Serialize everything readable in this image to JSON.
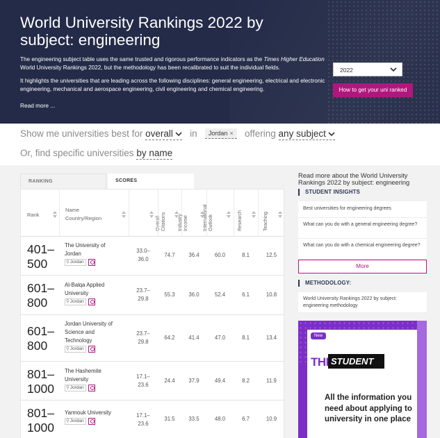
{
  "hero": {
    "title": "World University Rankings 2022 by subject: engineering",
    "desc1_em": "Times Higher Education",
    "desc1_pre": "The engineering subject table uses the same trusted and rigorous performance indicators as the ",
    "desc1_post": " World University Rankings 2022, but the methodology has been recalibrated to suit the individual fields.",
    "desc2": "It highlights the universities that are leading across the following disciplines: general engineering, electrical and electronic engineering, mechanical and aerospace engineering, civil engineering and chemical engineering.",
    "read_more": "Read more ...",
    "year_selected": "2022",
    "cta_label": "How to get your uni ranked"
  },
  "filters": {
    "show_me": "Show me universities best for",
    "sort_value": "overall",
    "in_label": "in",
    "country_chip": "Jordan",
    "chip_remove": "×",
    "offering_label": "offering",
    "subject_value": "any subject",
    "find_label": "Or, find specific universities",
    "find_value": "by name"
  },
  "tabs": {
    "ranking": "RANKING",
    "scores": "SCORES"
  },
  "table": {
    "headers": {
      "rank": "Rank",
      "name": "Name",
      "country": "Country/Region",
      "overall": "Overall",
      "citations": "Citations",
      "industry_1": "Industry",
      "industry_2": "Income",
      "intl_1": "International",
      "intl_2": "Outlook",
      "research": "Research",
      "teaching": "Teaching"
    },
    "rows": [
      {
        "rank_a": "401–",
        "rank_b": "500",
        "name": [
          "The University of",
          "Jordan"
        ],
        "country": "Jordan",
        "overall_a": "33.0–",
        "overall_b": "36.0",
        "citations": "74.7",
        "industry": "36.4",
        "intl": "60.0",
        "research": "8.1",
        "teaching": "12.5"
      },
      {
        "rank_a": "601–",
        "rank_b": "800",
        "name": [
          "Al-Balqa Applied",
          "University"
        ],
        "country": "Jordan",
        "overall_a": "23.7–",
        "overall_b": "29.8",
        "citations": "55.3",
        "industry": "36.0",
        "intl": "52.4",
        "research": "6.1",
        "teaching": "10.8"
      },
      {
        "rank_a": "601–",
        "rank_b": "800",
        "name": [
          "Jordan University of",
          "Science and",
          "Technology"
        ],
        "country": "Jordan",
        "overall_a": "23.7–",
        "overall_b": "29.8",
        "citations": "64.2",
        "industry": "41.4",
        "intl": "47.0",
        "research": "8.1",
        "teaching": "13.4"
      },
      {
        "rank_a": "801–",
        "rank_b": "1000",
        "name": [
          "The Hashemite",
          "University"
        ],
        "country": "Jordan",
        "overall_a": "17.1–",
        "overall_b": "23.6",
        "citations": "24.4",
        "industry": "37.9",
        "intl": "49.4",
        "research": "8.2",
        "teaching": "11.9"
      },
      {
        "rank_a": "801–",
        "rank_b": "1000",
        "name": [
          "Yarmouk University"
        ],
        "country": "Jordan",
        "overall_a": "17.1–",
        "overall_b": "23.6",
        "citations": "31.5",
        "industry": "33.5",
        "intl": "48.0",
        "research": "6.7",
        "teaching": "10.9"
      }
    ]
  },
  "sidebar": {
    "title": "Read more about the World University Rankings 2022 by subject: engineering",
    "insights_head": "STUDENT INSIGHTS",
    "insights": [
      "Best universities for engineering degrees",
      "What can you do with a general engineering degree?",
      "What can you do with a chemical engineering degree?"
    ],
    "more_label": "More",
    "methodology_head": "METHODOLOGY:",
    "methodology_link": "World University Rankings 2022 by subject: engineering methodology",
    "promo": {
      "badge": "New",
      "the": "THE",
      "student": "STUDENT",
      "text": "All the information you need about applying to university in one place"
    }
  },
  "colors": {
    "hero_bg": "#242b48",
    "accent": "#b0177d",
    "promo": "#7b2fc7"
  }
}
